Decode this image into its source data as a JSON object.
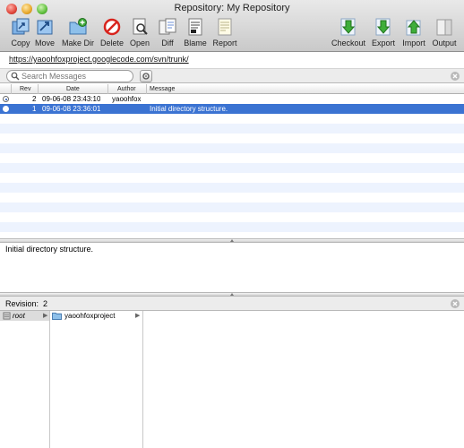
{
  "window": {
    "title": "Repository: My Repository"
  },
  "toolbar": {
    "left": [
      {
        "label": "Copy",
        "icon": "copy-icon"
      },
      {
        "label": "Move",
        "icon": "move-icon"
      },
      {
        "label": "Make Dir",
        "icon": "folder-plus-icon"
      },
      {
        "label": "Delete",
        "icon": "delete-icon"
      },
      {
        "label": "Open",
        "icon": "open-icon"
      },
      {
        "label": "Diff",
        "icon": "diff-icon"
      },
      {
        "label": "Blame",
        "icon": "blame-icon"
      },
      {
        "label": "Report",
        "icon": "report-icon"
      }
    ],
    "right": [
      {
        "label": "Checkout",
        "icon": "checkout-icon"
      },
      {
        "label": "Export",
        "icon": "export-icon"
      },
      {
        "label": "Import",
        "icon": "import-icon"
      },
      {
        "label": "Output",
        "icon": "output-icon"
      }
    ]
  },
  "repository": {
    "url_host": "https://yaoohfoxproject.googlecode.com/svn/",
    "url_path": "trunk/"
  },
  "search": {
    "placeholder": "Search Messages"
  },
  "log_table": {
    "columns": [
      "Rev",
      "Date",
      "Author",
      "Message"
    ],
    "rows": [
      {
        "rev": "2",
        "date": "09-06-08 23:43:10",
        "author": "yaoohfox",
        "message": "",
        "selected": false,
        "radio_on": true
      },
      {
        "rev": "1",
        "date": "09-06-08 23:36:01",
        "author": "",
        "message": "Initial directory structure.",
        "selected": true,
        "radio_on": false
      }
    ]
  },
  "message_pane": {
    "text": "Initial directory structure."
  },
  "revision_bar": {
    "label": "Revision:",
    "value": "2"
  },
  "browser": {
    "column1": {
      "label": "root"
    },
    "column2": {
      "label": "yaoohfoxproject"
    }
  },
  "colors": {
    "selection": "#3b73d2",
    "stripe": "#edf3fe"
  }
}
